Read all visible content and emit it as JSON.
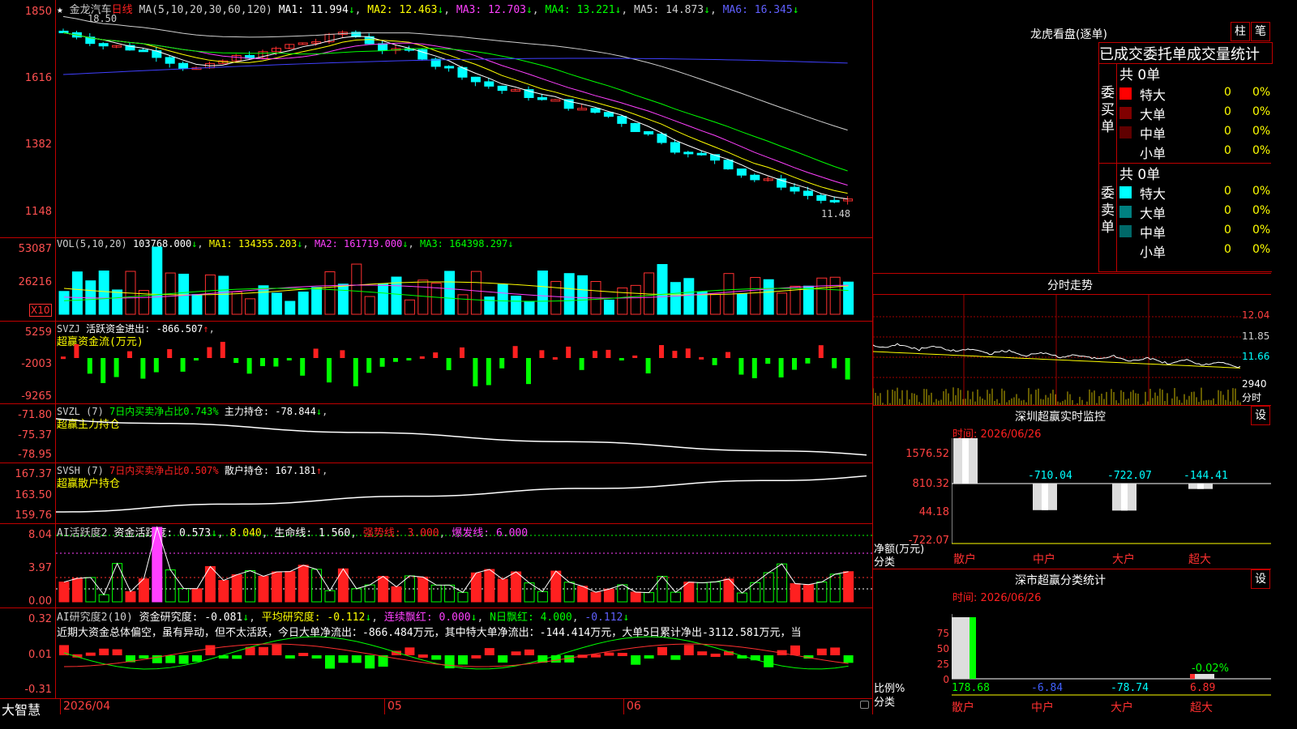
{
  "stock": {
    "name": "金龙汽车",
    "period": "日线",
    "star": "★"
  },
  "main_header": {
    "ma_label": "MA(5,10,20,30,60,120)",
    "items": [
      {
        "label": "MA1: 11.994",
        "color": "#ffffff"
      },
      {
        "label": "MA2: 12.463",
        "color": "#ffff00"
      },
      {
        "label": "MA3: 12.703",
        "color": "#ff40ff"
      },
      {
        "label": "MA4: 13.221",
        "color": "#00ff00"
      },
      {
        "label": "MA5: 14.873",
        "color": "#cfcfcf"
      },
      {
        "label": "MA6: 16.345",
        "color": "#4040ff"
      }
    ]
  },
  "main_axis": [
    "1850",
    "1616",
    "1382",
    "1148"
  ],
  "price_high": "18.50",
  "price_low": "11.48",
  "vol": {
    "title": "VOL(5,10,20)",
    "value": "103768.000",
    "ma1": "MA1: 134355.203",
    "ma2": "MA2: 161719.000",
    "ma3": "MA3: 164398.297",
    "axis": [
      "53087",
      "26216"
    ],
    "unit": "X10"
  },
  "svzj": {
    "title": "SVZJ",
    "active_label": "活跃资金进出: -866.507",
    "sub": "超赢资金流(万元)",
    "axis": [
      "5259",
      "-2003",
      "-9265"
    ]
  },
  "svzl": {
    "title": "SVZL (7)",
    "ratio": "7日内买卖净占比0.743%",
    "hold": "主力持仓: -78.844",
    "sub": "超赢主力持仓",
    "axis": [
      "-71.80",
      "-75.37",
      "-78.95"
    ]
  },
  "svsh": {
    "title": "SVSH (7)",
    "ratio": "7日内买卖净占比0.507%",
    "hold": "散户持仓: 167.181",
    "sub": "超赢散户持仓",
    "axis": [
      "167.37",
      "163.50",
      "159.76"
    ]
  },
  "ai_active": {
    "title": "AI活跃度2",
    "a": "资金活跃度: 0.573",
    "b": "8.040",
    "c": "生命线: 1.560",
    "d": "强势线: 3.000",
    "e": "爆发线: 6.000",
    "axis": [
      "8.04",
      "3.97",
      "0.00"
    ]
  },
  "ai_research": {
    "title": "AI研究度2(10)",
    "a": "资金研究度: -0.081",
    "b": "平均研究度: -0.112",
    "c": "连续飘红: 0.000",
    "d": "N日飘红: 4.000",
    "e": "-0.112",
    "axis": [
      "0.32",
      "0.01",
      "-0.31"
    ],
    "note": "近期大资金总体偏空，虽有异动，但不太活跃，今日大单净流出：-866.484万元，其中特大单净流出：-144.414万元，大单5日累计净出-3112.581万元，当"
  },
  "bottom": {
    "logo": "大智慧",
    "dates": [
      "2026/04",
      "05",
      "06"
    ]
  },
  "dragon": {
    "title": "龙虎看盘(逐单)",
    "btn1": "柱",
    "btn2": "笔",
    "header": "已成交委托单成交量统计",
    "buy_label": "委买单",
    "sell_label": "委卖单",
    "buy_total": "共 0单",
    "sell_total": "共 0单",
    "buy_rows": [
      {
        "name": "特大",
        "count": "0",
        "pct": "0%",
        "color": "#ff0000"
      },
      {
        "name": "大单",
        "count": "0",
        "pct": "0%",
        "color": "#800000"
      },
      {
        "name": "中单",
        "count": "0",
        "pct": "0%",
        "color": "#600000"
      },
      {
        "name": "小单",
        "count": "0",
        "pct": "0%",
        "color": "#000000"
      }
    ],
    "sell_rows": [
      {
        "name": "特大",
        "count": "0",
        "pct": "0%",
        "color": "#00ffff"
      },
      {
        "name": "大单",
        "count": "0",
        "pct": "0%",
        "color": "#008080"
      },
      {
        "name": "中单",
        "count": "0",
        "pct": "0%",
        "color": "#006868"
      },
      {
        "name": "小单",
        "count": "0",
        "pct": "0%",
        "color": "#000000"
      }
    ]
  },
  "intraday": {
    "title": "分时走势",
    "axis": [
      "12.04",
      "11.85",
      "11.66"
    ],
    "vol": "2940",
    "vol_unit": "分时"
  },
  "monitor": {
    "title": "深圳超赢实时监控",
    "btn": "设",
    "time": "时间: 2026/06/26",
    "axis": [
      "1576.52",
      "810.32",
      "44.18",
      "-722.07"
    ],
    "left_label1": "净额(万元)",
    "left_label2": "分类",
    "bars": [
      {
        "cat": "散户",
        "value": "1576.52"
      },
      {
        "cat": "中户",
        "value": "-710.04"
      },
      {
        "cat": "大户",
        "value": "-722.07"
      },
      {
        "cat": "超大",
        "value": "-144.41"
      }
    ]
  },
  "classify": {
    "title": "深市超赢分类统计",
    "btn": "设",
    "time": "时间: 2026/06/26",
    "axis": [
      "75",
      "50",
      "25",
      "0"
    ],
    "left_label1": "比例%",
    "left_label2": "分类",
    "extra": "-0.02%",
    "bars": [
      {
        "cat": "散户",
        "value": "178.68"
      },
      {
        "cat": "中户",
        "value": "-6.84"
      },
      {
        "cat": "大户",
        "value": "-78.74"
      },
      {
        "cat": "超大",
        "value": "6.89"
      }
    ]
  }
}
